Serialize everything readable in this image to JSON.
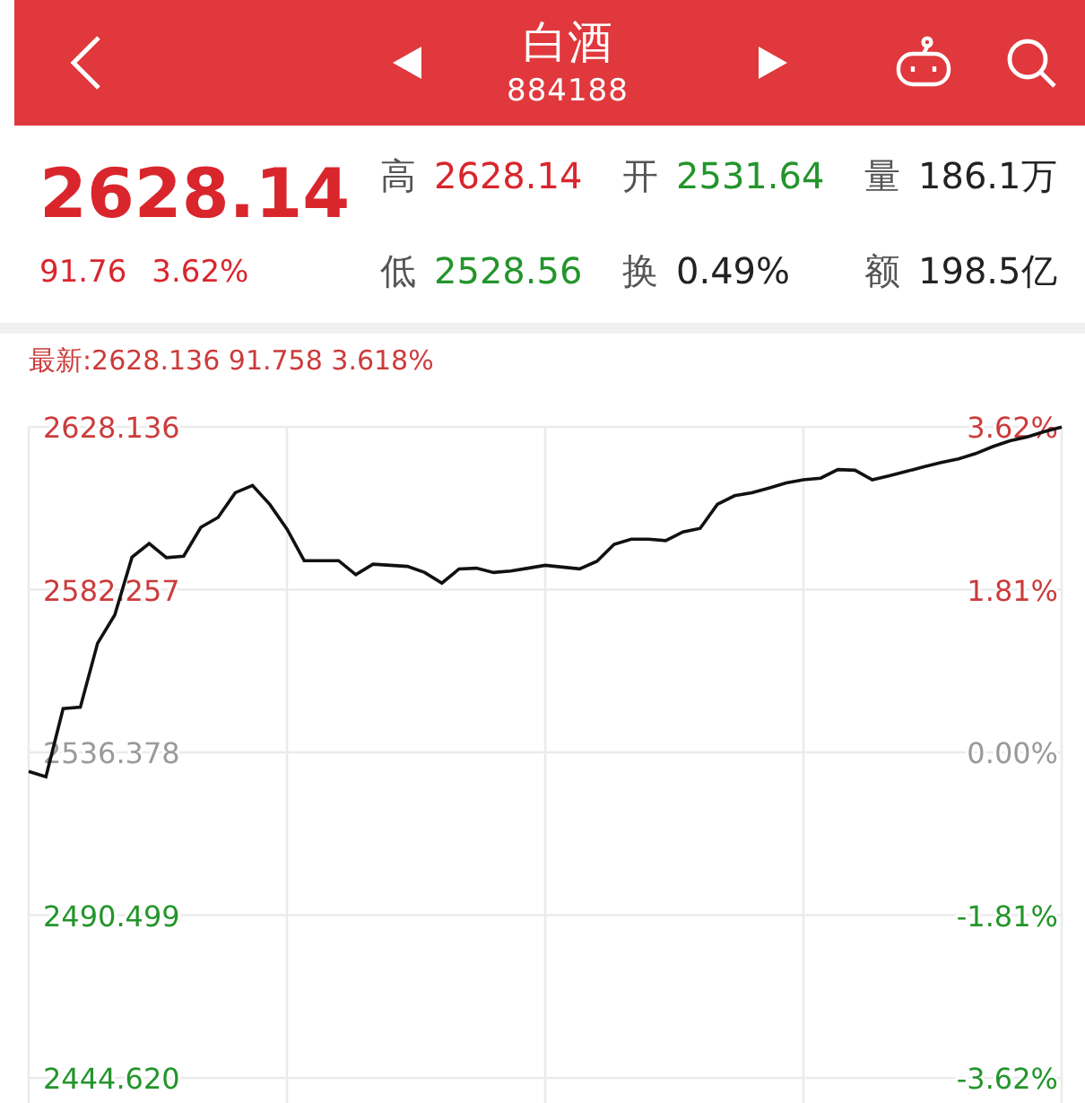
{
  "header": {
    "title": "白酒",
    "code": "884188"
  },
  "quote": {
    "price": "2628.14",
    "change": "91.76",
    "change_pct": "3.62%",
    "color": "#d9262c"
  },
  "stats": [
    {
      "label": "高",
      "value": "2628.14",
      "color": "#d9262c"
    },
    {
      "label": "开",
      "value": "2531.64",
      "color": "#23952b"
    },
    {
      "label": "量",
      "value": "186.1万",
      "color": "#222222"
    },
    {
      "label": "低",
      "value": "2528.56",
      "color": "#23952b"
    },
    {
      "label": "换",
      "value": "0.49%",
      "color": "#222222"
    },
    {
      "label": "额",
      "value": "198.5亿",
      "color": "#222222"
    }
  ],
  "chart": {
    "legend": "最新:2628.136 91.758 3.618%",
    "percent_labels": [
      {
        "label": "3.62%",
        "color": "#cc3b3b"
      },
      {
        "label": "1.81%",
        "color": "#cc3b3b"
      },
      {
        "label": "0.00%",
        "color": "#9a9a9a"
      },
      {
        "label": "-1.81%",
        "color": "#23952b"
      },
      {
        "label": "-3.62%",
        "color": "#23952b"
      }
    ],
    "chart_data": {
      "type": "line",
      "grid": true,
      "ylim": [
        2444.62,
        2628.136
      ],
      "yticks": [
        {
          "value": 2628.136,
          "label": "2628.136"
        },
        {
          "value": 2582.257,
          "label": "2582.257"
        },
        {
          "value": 2536.378,
          "label": "2536.378"
        },
        {
          "value": 2490.499,
          "label": "2490.499"
        },
        {
          "value": 2444.62,
          "label": "2444.620"
        }
      ],
      "series": [
        {
          "color": "#111111",
          "values": [
            2531.0,
            2529.5,
            2548.7,
            2549.1,
            2567.1,
            2575.1,
            2591.4,
            2595.3,
            2591.3,
            2591.7,
            2599.8,
            2602.6,
            2609.6,
            2611.6,
            2606.3,
            2599.3,
            2590.4,
            2590.4,
            2590.4,
            2586.5,
            2589.4,
            2589.1,
            2588.8,
            2587.1,
            2584.1,
            2588.1,
            2588.3,
            2587.1,
            2587.5,
            2588.3,
            2589.1,
            2588.6,
            2588.1,
            2590.2,
            2595.0,
            2596.5,
            2596.5,
            2596.1,
            2598.5,
            2599.5,
            2606.3,
            2608.7,
            2609.6,
            2610.9,
            2612.3,
            2613.2,
            2613.7,
            2616.1,
            2615.9,
            2613.2,
            2614.4,
            2615.6,
            2616.9,
            2618.1,
            2619.1,
            2620.6,
            2622.6,
            2624.2,
            2625.3,
            2626.8,
            2628.1
          ]
        }
      ]
    }
  }
}
